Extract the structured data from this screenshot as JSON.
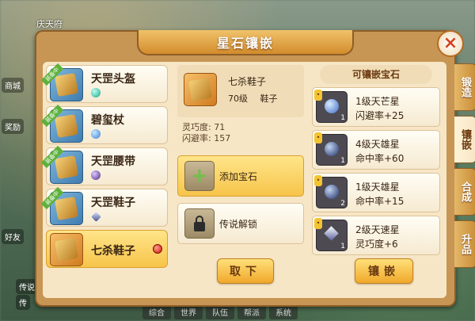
{
  "panel": {
    "title": "星石镶嵌",
    "close_label": "×"
  },
  "background": {
    "location": "庆天府",
    "chips": [
      "商城",
      "奖励",
      "好友",
      "传说",
      "传"
    ],
    "bottom_tabs": [
      "综合",
      "世界",
      "队伍",
      "帮派",
      "系统"
    ]
  },
  "equipment": [
    {
      "name": "天罡头盔",
      "gem": "teal",
      "equipped_tag": "装备中",
      "selected": false
    },
    {
      "name": "碧玺杖",
      "gem": "blue",
      "equipped_tag": "装备中",
      "selected": false
    },
    {
      "name": "天罡腰带",
      "gem": "purple",
      "equipped_tag": "装备中",
      "selected": false
    },
    {
      "name": "天罡鞋子",
      "gem": "shard",
      "equipped_tag": "装备中",
      "selected": false
    },
    {
      "name": "七杀鞋子",
      "gem": "",
      "equipped_tag": "",
      "selected": true
    }
  ],
  "detail": {
    "name": "七杀鞋子",
    "level": "70级",
    "type": "鞋子",
    "stats": [
      "灵巧度: 71",
      "闪避率: 157"
    ],
    "slot_add_label": "添加宝石",
    "slot_lock_label": "传说解锁",
    "remove_button": "取下"
  },
  "gems": {
    "title": "可镶嵌宝石",
    "items": [
      {
        "name": "1级天芒星",
        "effect": "闪避率+25",
        "count": "1",
        "icon": "orb"
      },
      {
        "name": "4级天雄星",
        "effect": "命中率+60",
        "count": "1",
        "icon": "orb-dark"
      },
      {
        "name": "1级天雄星",
        "effect": "命中率+15",
        "count": "2",
        "icon": "orb-dark"
      },
      {
        "name": "2级天速星",
        "effect": "灵巧度+6",
        "count": "1",
        "icon": "shard"
      }
    ],
    "embed_button": "镶嵌"
  },
  "side_tabs": [
    {
      "label": "锻造",
      "active": false
    },
    {
      "label": "镶嵌",
      "active": true
    },
    {
      "label": "合成",
      "active": false
    },
    {
      "label": "升品",
      "active": false
    }
  ]
}
